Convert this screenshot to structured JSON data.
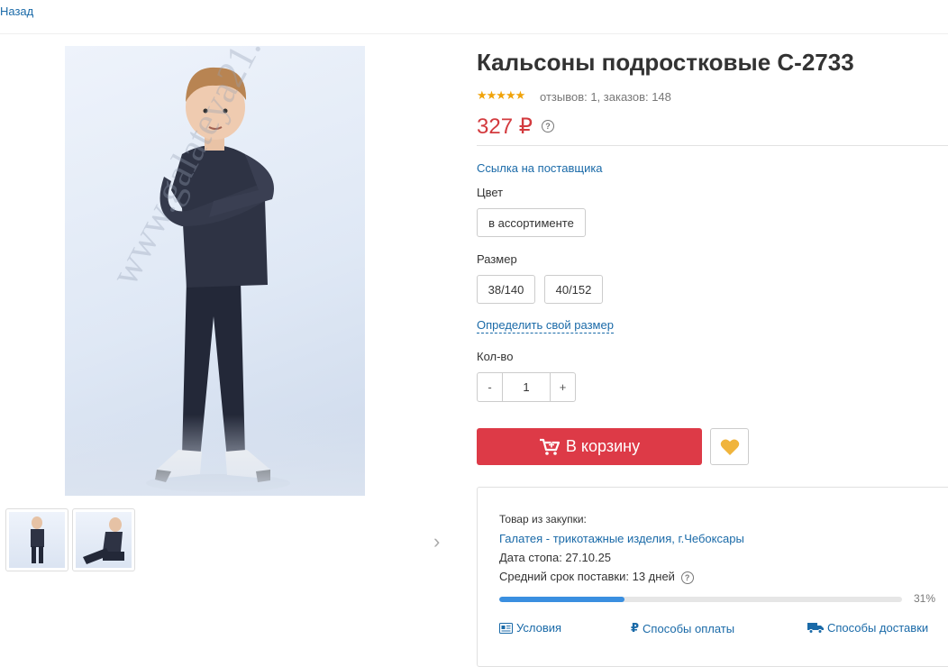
{
  "nav": {
    "back_label": "Назад"
  },
  "gallery": {
    "watermark": "www.galateya21.ru",
    "thumbnails": 2
  },
  "product": {
    "title": "Кальсоны подростковые С-2733",
    "stars": "★★★★★",
    "reviews": "отзывов: 1, заказов: 148",
    "price": "327 ₽",
    "price_help": "?",
    "supplier_link": "Ссылка на поставщика",
    "color_label": "Цвет",
    "color_option": "в ассортименте",
    "size_label": "Размер",
    "sizes": [
      "38/140",
      "40/152"
    ],
    "size_help_link": "Определить свой размер",
    "qty_label": "Кол-во",
    "qty_minus": "-",
    "qty_value": "1",
    "qty_plus": "+",
    "cart_button": "В корзину"
  },
  "purchase": {
    "from_label": "Товар из закупки:",
    "supplier_name": "Галатея - трикотажные изделия, г.Чебоксары",
    "stop_date": "Дата стопа: 27.10.25",
    "delivery_time": "Средний срок поставки: 13 дней",
    "help": "?",
    "progress_percent": 31,
    "progress_label": "31%",
    "links": {
      "terms": "Условия",
      "payment": "Способы оплаты",
      "delivery": "Способы доставки"
    }
  },
  "colors": {
    "accent_red": "#dd3a47",
    "price_red": "#d33a3e",
    "link_blue": "#1a6aa8",
    "star_orange": "#f0a30a",
    "heart_gold": "#f0b43c",
    "progress_blue": "#3a8fe0"
  }
}
